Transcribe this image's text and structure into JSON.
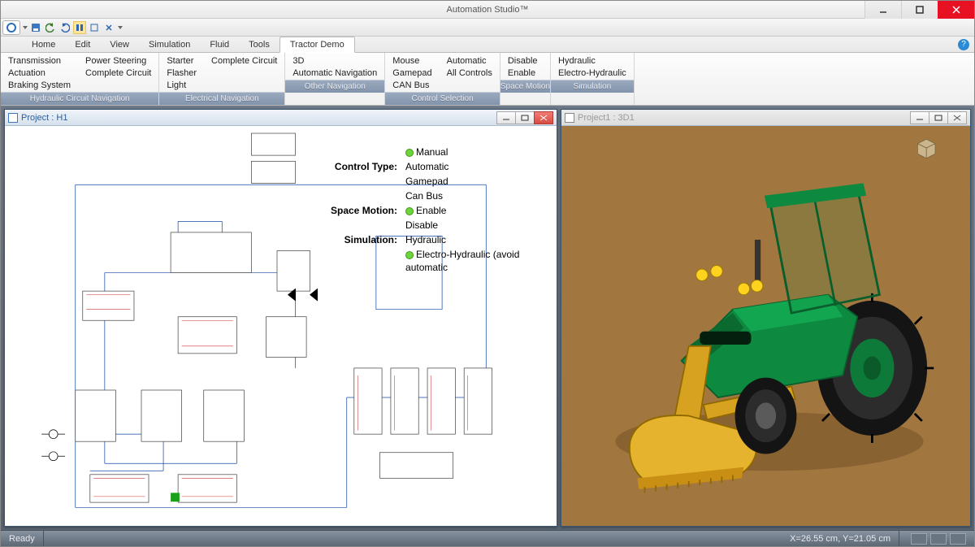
{
  "titlebar": {
    "title": "Automation Studio™"
  },
  "ribbon": {
    "tabs": [
      "Home",
      "Edit",
      "View",
      "Simulation",
      "Fluid",
      "Tools",
      "Tractor Demo"
    ],
    "active_tab": 6,
    "groups": [
      {
        "label": "Hydraulic Circuit Navigation",
        "cols": [
          [
            "Transmission",
            "Actuation",
            "Braking System"
          ],
          [
            "Power Steering",
            "Complete Circuit"
          ]
        ]
      },
      {
        "label": "Electrical Navigation",
        "cols": [
          [
            "Starter",
            "Flasher",
            "Light"
          ],
          [
            "Complete Circuit"
          ]
        ]
      },
      {
        "label": "Other Navigation",
        "cols": [
          [
            "3D",
            "Automatic Navigation"
          ]
        ]
      },
      {
        "label": "Control Selection",
        "cols": [
          [
            "Mouse",
            "Gamepad",
            "CAN Bus"
          ],
          [
            "Automatic",
            "All Controls"
          ]
        ]
      },
      {
        "label": "Space Motion",
        "cols": [
          [
            "Disable",
            "Enable"
          ]
        ]
      },
      {
        "label": "Simulation",
        "cols": [
          [
            "Hydraulic",
            "Electro-Hydraulic"
          ]
        ]
      }
    ]
  },
  "panels": {
    "left": {
      "title": "Project : H1",
      "info": {
        "rows": [
          {
            "label": "",
            "value": "Manual",
            "dot": true
          },
          {
            "label": "Control Type:",
            "value": "Automatic"
          },
          {
            "label": "",
            "value": "Gamepad"
          },
          {
            "label": "",
            "value": "Can Bus"
          },
          {
            "label": "Space Motion:",
            "value": "Enable",
            "dot": true
          },
          {
            "label": "",
            "value": "Disable"
          },
          {
            "label": "Simulation:",
            "value": "Hydraulic"
          },
          {
            "label": "",
            "value": "Electro-Hydraulic (avoid automatic",
            "dot": true
          }
        ]
      }
    },
    "right": {
      "title": "Project1 : 3D1"
    }
  },
  "statusbar": {
    "ready": "Ready",
    "coords": "X=26.55 cm, Y=21.05 cm"
  }
}
